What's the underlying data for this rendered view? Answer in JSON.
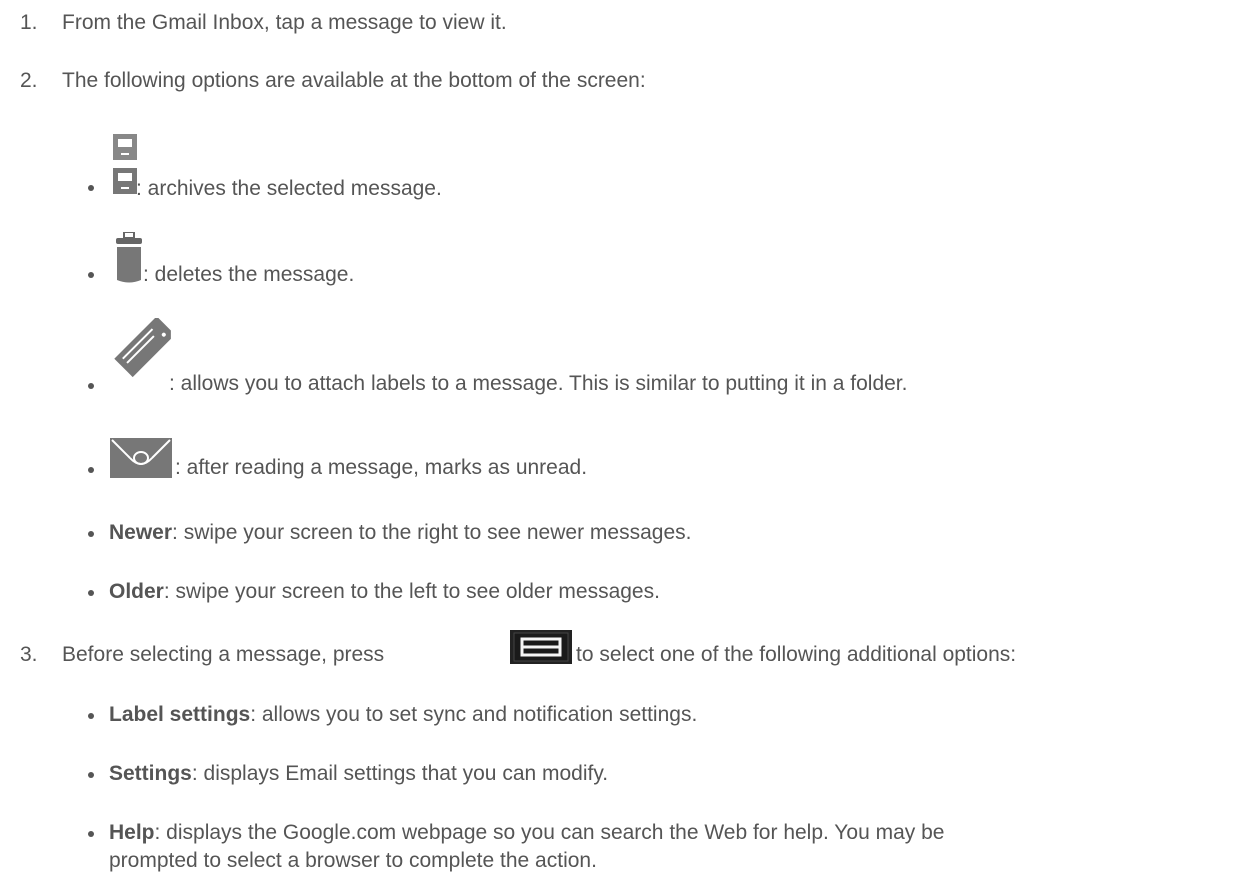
{
  "steps": [
    {
      "number": "1.",
      "text": "From the Gmail Inbox, tap a message to view it."
    },
    {
      "number": "2.",
      "text": "The following options are available at the bottom of the screen:"
    },
    {
      "number": "3.",
      "text_before": "Before selecting a message, press",
      "text_after": "to select one of the following additional options:"
    }
  ],
  "icon_options": [
    {
      "icon": "archive-icon",
      "text": ": archives the selected message."
    },
    {
      "icon": "trash-icon",
      "text": ": deletes the message."
    },
    {
      "icon": "label-tag-icon",
      "text": ": allows you to attach labels to a message. This is similar to putting it in a folder."
    },
    {
      "icon": "mark-unread-icon",
      "text": ": after reading a message, marks as unread."
    }
  ],
  "swipe_options": [
    {
      "term": "Newer",
      "text": ": swipe your screen to the right to see newer messages."
    },
    {
      "term": "Older",
      "text": ": swipe your screen to the left to see older messages."
    }
  ],
  "menu_options": [
    {
      "term": "Label settings",
      "text": ": allows you to set sync and notification settings."
    },
    {
      "term": "Settings",
      "text": ": displays Email settings that you can modify."
    },
    {
      "term": "Help",
      "text": ": displays the Google.com webpage so you can search the Web for help. You may be",
      "continuation": "prompted to select a browser to complete the action."
    }
  ],
  "menu_key_icon": "menu-key-icon",
  "colors": {
    "text": "#555555",
    "icon": "#777777"
  }
}
